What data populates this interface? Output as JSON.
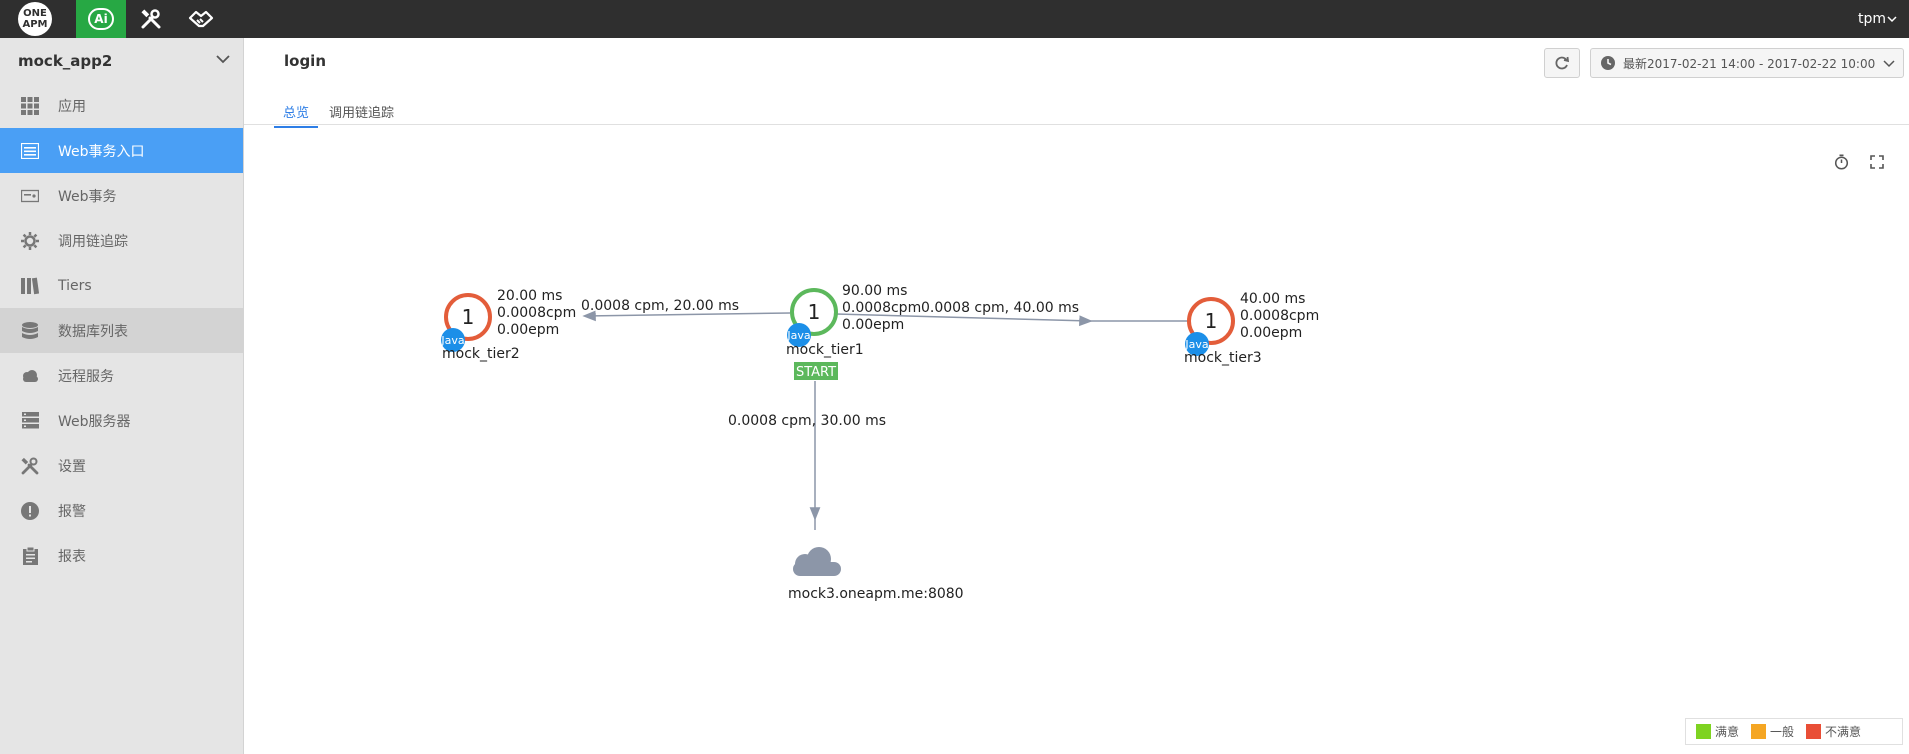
{
  "topbar": {
    "logo_text": "ONE APM",
    "ai_label": "Ai",
    "user": "tpm"
  },
  "sidebar": {
    "app_name": "mock_app2",
    "items": [
      {
        "label": "应用",
        "icon": "grid-icon"
      },
      {
        "label": "Web事务入口",
        "icon": "list-icon",
        "active": true
      },
      {
        "label": "Web事务",
        "icon": "transaction-icon"
      },
      {
        "label": "调用链追踪",
        "icon": "gear-icon"
      },
      {
        "label": "Tiers",
        "icon": "columns-icon"
      },
      {
        "label": "数据库列表",
        "icon": "database-icon",
        "hover": true
      },
      {
        "label": "远程服务",
        "icon": "cloud-icon"
      },
      {
        "label": "Web服务器",
        "icon": "server-icon"
      },
      {
        "label": "设置",
        "icon": "tools-icon"
      },
      {
        "label": "报警",
        "icon": "alert-icon"
      },
      {
        "label": "报表",
        "icon": "clipboard-icon"
      }
    ]
  },
  "main": {
    "title": "login",
    "time_range": "最新2017-02-21 14:00 - 2017-02-22 10:00",
    "tabs": [
      {
        "label": "总览",
        "active": true
      },
      {
        "label": "调用链追踪",
        "active": false
      }
    ]
  },
  "topology": {
    "nodes": [
      {
        "id": "tier1",
        "count": "1",
        "name": "mock_tier1",
        "lang": "Java",
        "status": "satisfied",
        "metrics": [
          "90.00 ms",
          "0.0008cpm",
          "0.00epm"
        ],
        "badge": "START"
      },
      {
        "id": "tier2",
        "count": "1",
        "name": "mock_tier2",
        "lang": "Java",
        "status": "unsatisfied",
        "metrics": [
          "20.00 ms",
          "0.0008cpm",
          "0.00epm"
        ]
      },
      {
        "id": "tier3",
        "count": "1",
        "name": "mock_tier3",
        "lang": "Java",
        "status": "unsatisfied",
        "metrics": [
          "40.00 ms",
          "0.0008cpm",
          "0.00epm"
        ]
      }
    ],
    "external": {
      "name": "mock3.oneapm.me:8080",
      "icon": "cloud-icon"
    },
    "edges": [
      {
        "from": "tier1",
        "to": "tier2",
        "label": "0.0008 cpm, 20.00 ms"
      },
      {
        "from": "tier1",
        "to": "tier3",
        "label": "0.0008 cpm, 40.00 ms"
      },
      {
        "from": "tier1",
        "to": "external",
        "label": "0.0008 cpm, 30.00 ms"
      }
    ]
  },
  "legend": [
    {
      "label": "满意",
      "color": "#7ed321"
    },
    {
      "label": "一般",
      "color": "#f5a623"
    },
    {
      "label": "不满意",
      "color": "#e94e36"
    }
  ],
  "colors": {
    "satisfied": "#5cb85c",
    "unsatisfied": "#e35d3a",
    "java_badge": "#1c8fe8",
    "edge": "#8c96a8",
    "start_badge": "#5cb85c"
  }
}
